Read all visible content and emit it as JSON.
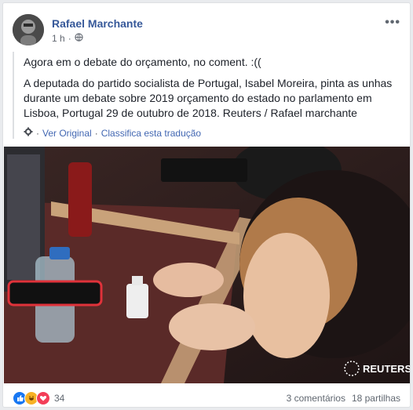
{
  "post": {
    "author": "Rafael Marchante",
    "time": "1 h",
    "more_label": "•••",
    "text_line1": "Agora em o debate do orçamento, no coment. :((",
    "text_line2": "A deputada do partido socialista de Portugal, Isabel Moreira, pinta as unhas durante um debate sobre 2019 orçamento do estado no parlamento em Lisboa, Portugal 29 de outubro de 2018. Reuters / Rafael marchante",
    "see_original": "Ver Original",
    "rate_translation": "Classifica esta tradução",
    "separator": "·"
  },
  "photo": {
    "watermark": "REUTERS"
  },
  "footer": {
    "reaction_count": "34",
    "comments": "3 comentários",
    "shares": "18 partilhas"
  },
  "colors": {
    "link": "#365899",
    "like": "#1877f2",
    "love": "#f33e58",
    "haha": "#f7b125"
  }
}
